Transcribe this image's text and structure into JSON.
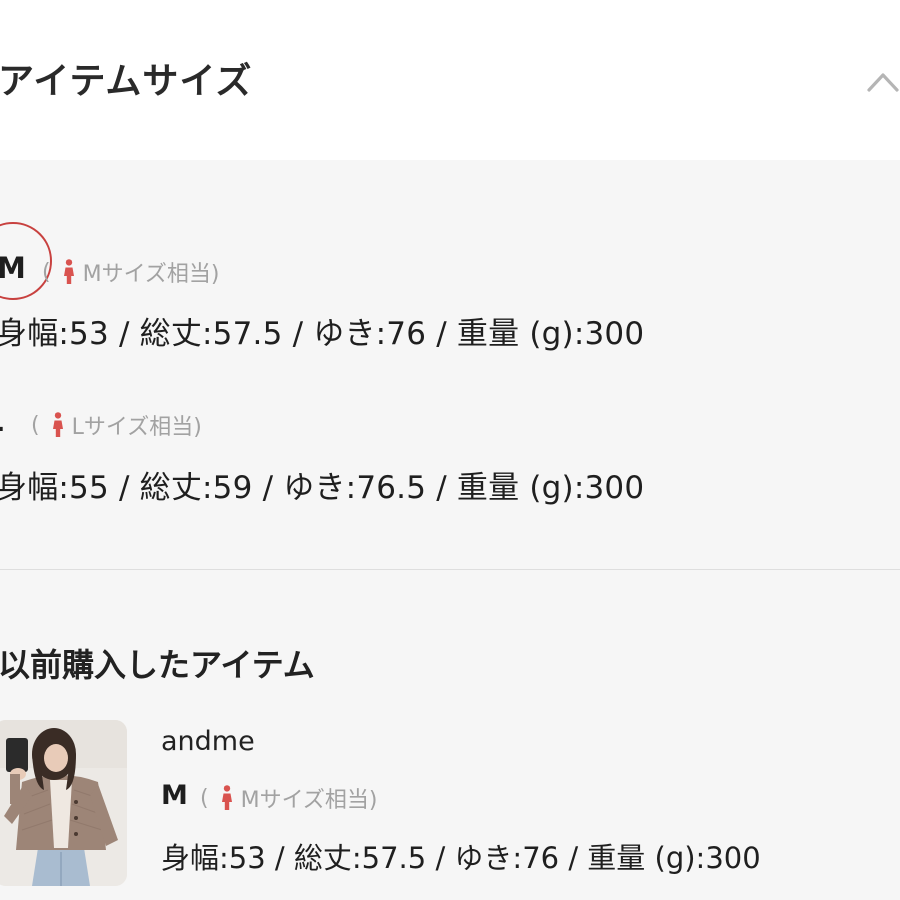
{
  "header": {
    "title": "アイテムサイズ",
    "toggle_icon": "chevron-up-icon"
  },
  "sizes": [
    {
      "label": "M",
      "equiv_open": "(",
      "equiv_text": "Mサイズ相当)",
      "icon": "woman-figure-icon",
      "measurements": "身幅:53 / 総丈:57.5 / ゆき:76 / 重量 (g):300",
      "circled": true
    },
    {
      "label": "L",
      "equiv_open": "(",
      "equiv_text": "Lサイズ相当)",
      "icon": "woman-figure-icon",
      "measurements": "身幅:55 / 総丈:59 / ゆき:76.5 / 重量 (g):300",
      "circled": false
    }
  ],
  "previous": {
    "title": "以前購入したアイテム",
    "item": {
      "brand": "andme",
      "size": "M",
      "equiv_open": "(",
      "equiv_text": "Mサイズ相当)",
      "icon": "woman-figure-icon",
      "measurements": "身幅:53 / 総丈:57.5 / ゆき:76 / 重量 (g):300"
    }
  },
  "colors": {
    "accent_circle": "#c8413f",
    "woman_icon": "#d9534f",
    "muted_text": "#a2a2a2"
  }
}
